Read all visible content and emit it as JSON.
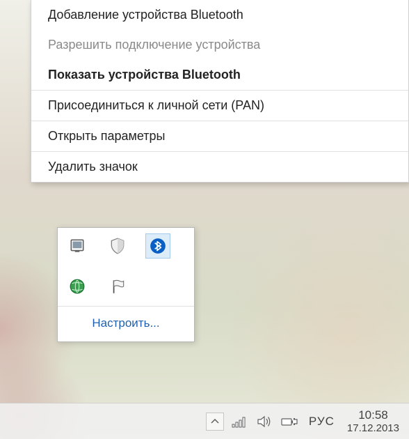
{
  "context_menu": {
    "items": [
      {
        "label": "Добавление устройства Bluetooth",
        "bold": false,
        "enabled": true
      },
      {
        "label": "Разрешить подключение устройства",
        "bold": false,
        "enabled": false
      },
      {
        "label": "Показать устройства Bluetooth",
        "bold": true,
        "enabled": true
      },
      {
        "label": "Присоединиться к личной сети (PAN)",
        "bold": false,
        "enabled": true
      },
      {
        "label": "Открыть параметры",
        "bold": false,
        "enabled": true
      },
      {
        "label": "Удалить значок",
        "bold": false,
        "enabled": true
      }
    ]
  },
  "tray_popup": {
    "customize_label": "Настроить...",
    "icons": [
      {
        "name": "device-icon"
      },
      {
        "name": "shield-icon"
      },
      {
        "name": "bluetooth-icon"
      },
      {
        "name": "globe-icon"
      },
      {
        "name": "flag-icon"
      }
    ]
  },
  "taskbar": {
    "language": "РУС",
    "time": "10:58",
    "date": "17.12.2013"
  }
}
